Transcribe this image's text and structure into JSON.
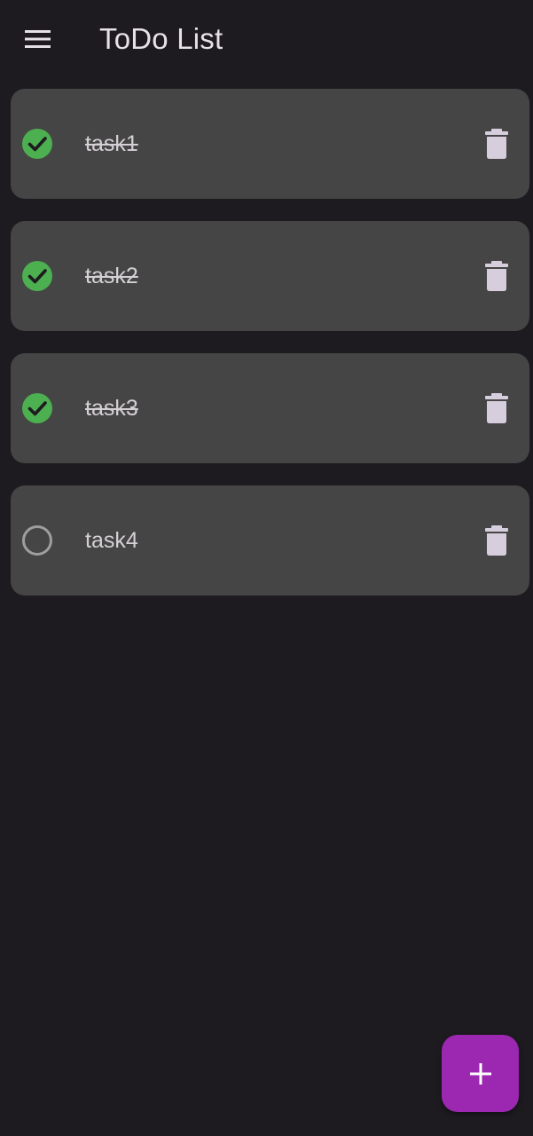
{
  "app_bar": {
    "title": "ToDo List",
    "menu_icon": "menu-icon"
  },
  "colors": {
    "background": "#1d1b20",
    "card": "#454545",
    "check_done": "#4caf50",
    "check_empty": "#9e9e9e",
    "delete_icon": "#d7cedd",
    "fab": "#9c27b0"
  },
  "tasks": [
    {
      "label": "task1",
      "done": true
    },
    {
      "label": "task2",
      "done": true
    },
    {
      "label": "task3",
      "done": true
    },
    {
      "label": "task4",
      "done": false
    }
  ],
  "fab": {
    "icon": "plus-icon"
  }
}
